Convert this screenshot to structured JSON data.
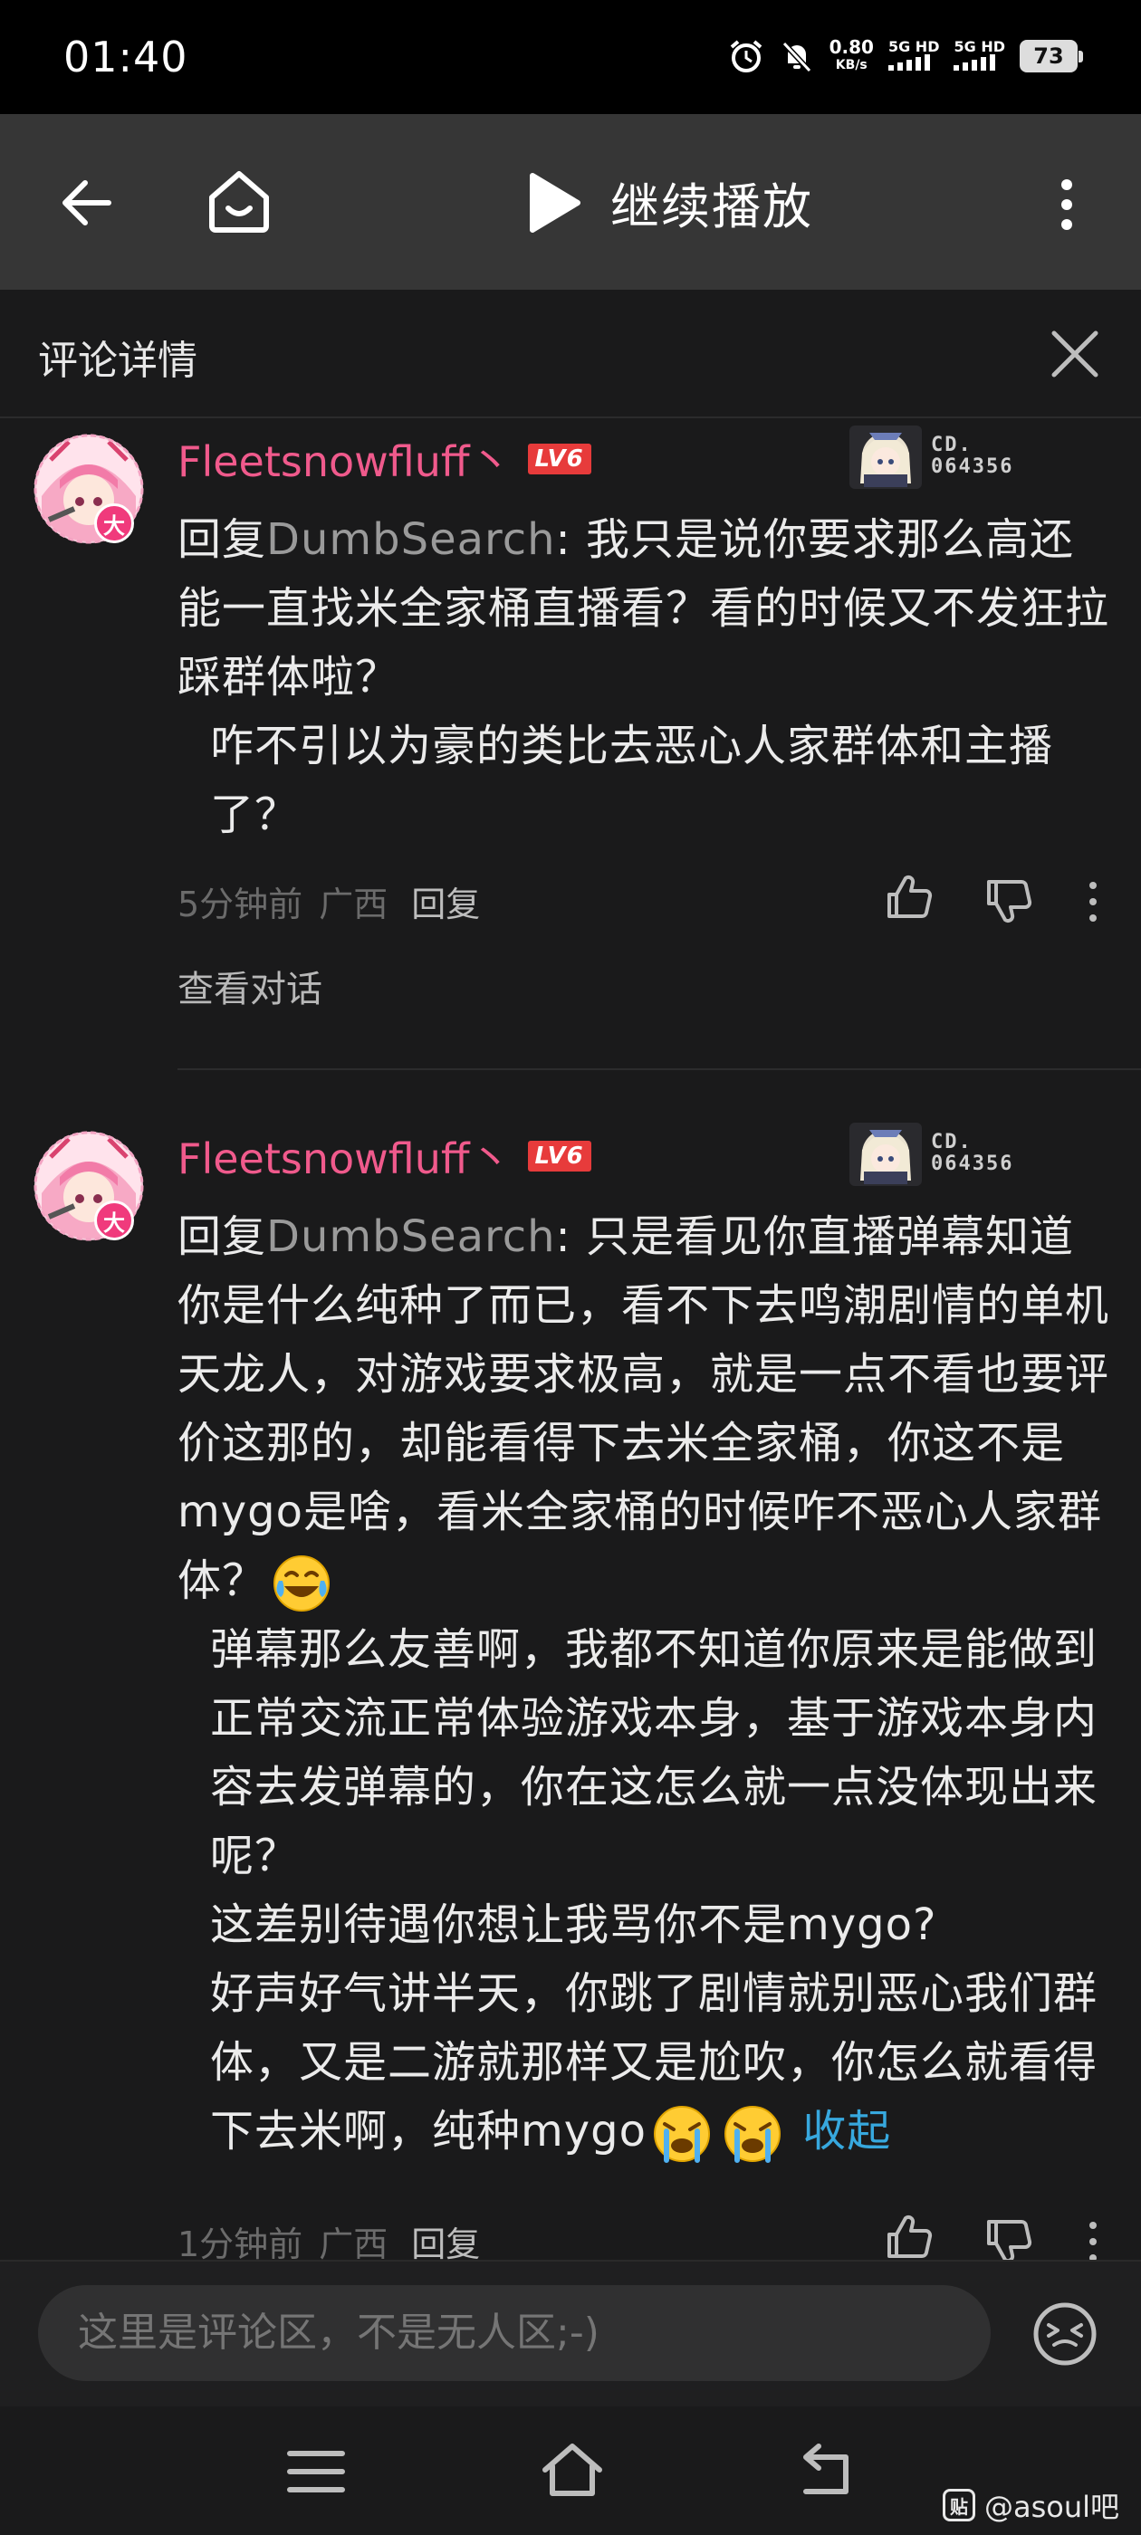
{
  "status_bar": {
    "time": "01:40",
    "net_speed_value": "0.80",
    "net_speed_unit": "KB/s",
    "sim1": "5G HD",
    "sim2": "5G HD",
    "battery": "73"
  },
  "header": {
    "play_title": "继续播放"
  },
  "section": {
    "title": "评论详情"
  },
  "comments": [
    {
      "username": "Fleetsnowfluff丶",
      "level": "LV6",
      "avatar_badge": "大",
      "fan_card_number_line1": "CD.",
      "fan_card_number_line2": "064356",
      "reply_prefix": "回复",
      "reply_target": "DumbSearch",
      "paragraphs": [
        ": 我只是说你要求那么高还能一直找米全家桶直播看？看的时候又不发狂拉踩群体啦？",
        "咋不引以为豪的类比去恶心人家群体和主播了？"
      ],
      "time": "5分钟前",
      "location": "广西",
      "reply_label": "回复",
      "view_conversation": "查看对话"
    },
    {
      "username": "Fleetsnowfluff丶",
      "level": "LV6",
      "avatar_badge": "大",
      "fan_card_number_line1": "CD.",
      "fan_card_number_line2": "064356",
      "reply_prefix": "回复",
      "reply_target": "DumbSearch",
      "paragraphs": [
        ": 只是看见你直播弹幕知道你是什么纯种了而已，看不下去鸣潮剧情的单机天龙人，对游戏要求极高，就是一点不看也要评价这那的，却能看得下去米全家桶，你这不是mygo是啥，看米全家桶的时候咋不恶心人家群体？",
        "弹幕那么友善啊，我都不知道你原来是能做到正常交流正常体验游戏本身，基于游戏本身内容去发弹幕的，你在这怎么就一点没体现出来呢？",
        "这差别待遇你想让我骂你不是mygo?",
        "好声好气讲半天，你跳了剧情就别恶心我们群体，又是二游就那样又是尬吹，你怎么就看得下去米啊，纯种mygo"
      ],
      "collapse_label": "收起",
      "time": "1分钟前",
      "location": "广西",
      "reply_label": "回复"
    }
  ],
  "input": {
    "placeholder": "这里是评论区，不是无人区;-)"
  },
  "watermark": {
    "logo": "贴",
    "text": "@asoul吧"
  },
  "colors": {
    "username": "#f05a8c",
    "level_badge": "#e73b3b",
    "link": "#37a8de",
    "background": "#1a1a1b",
    "header": "#363636"
  }
}
